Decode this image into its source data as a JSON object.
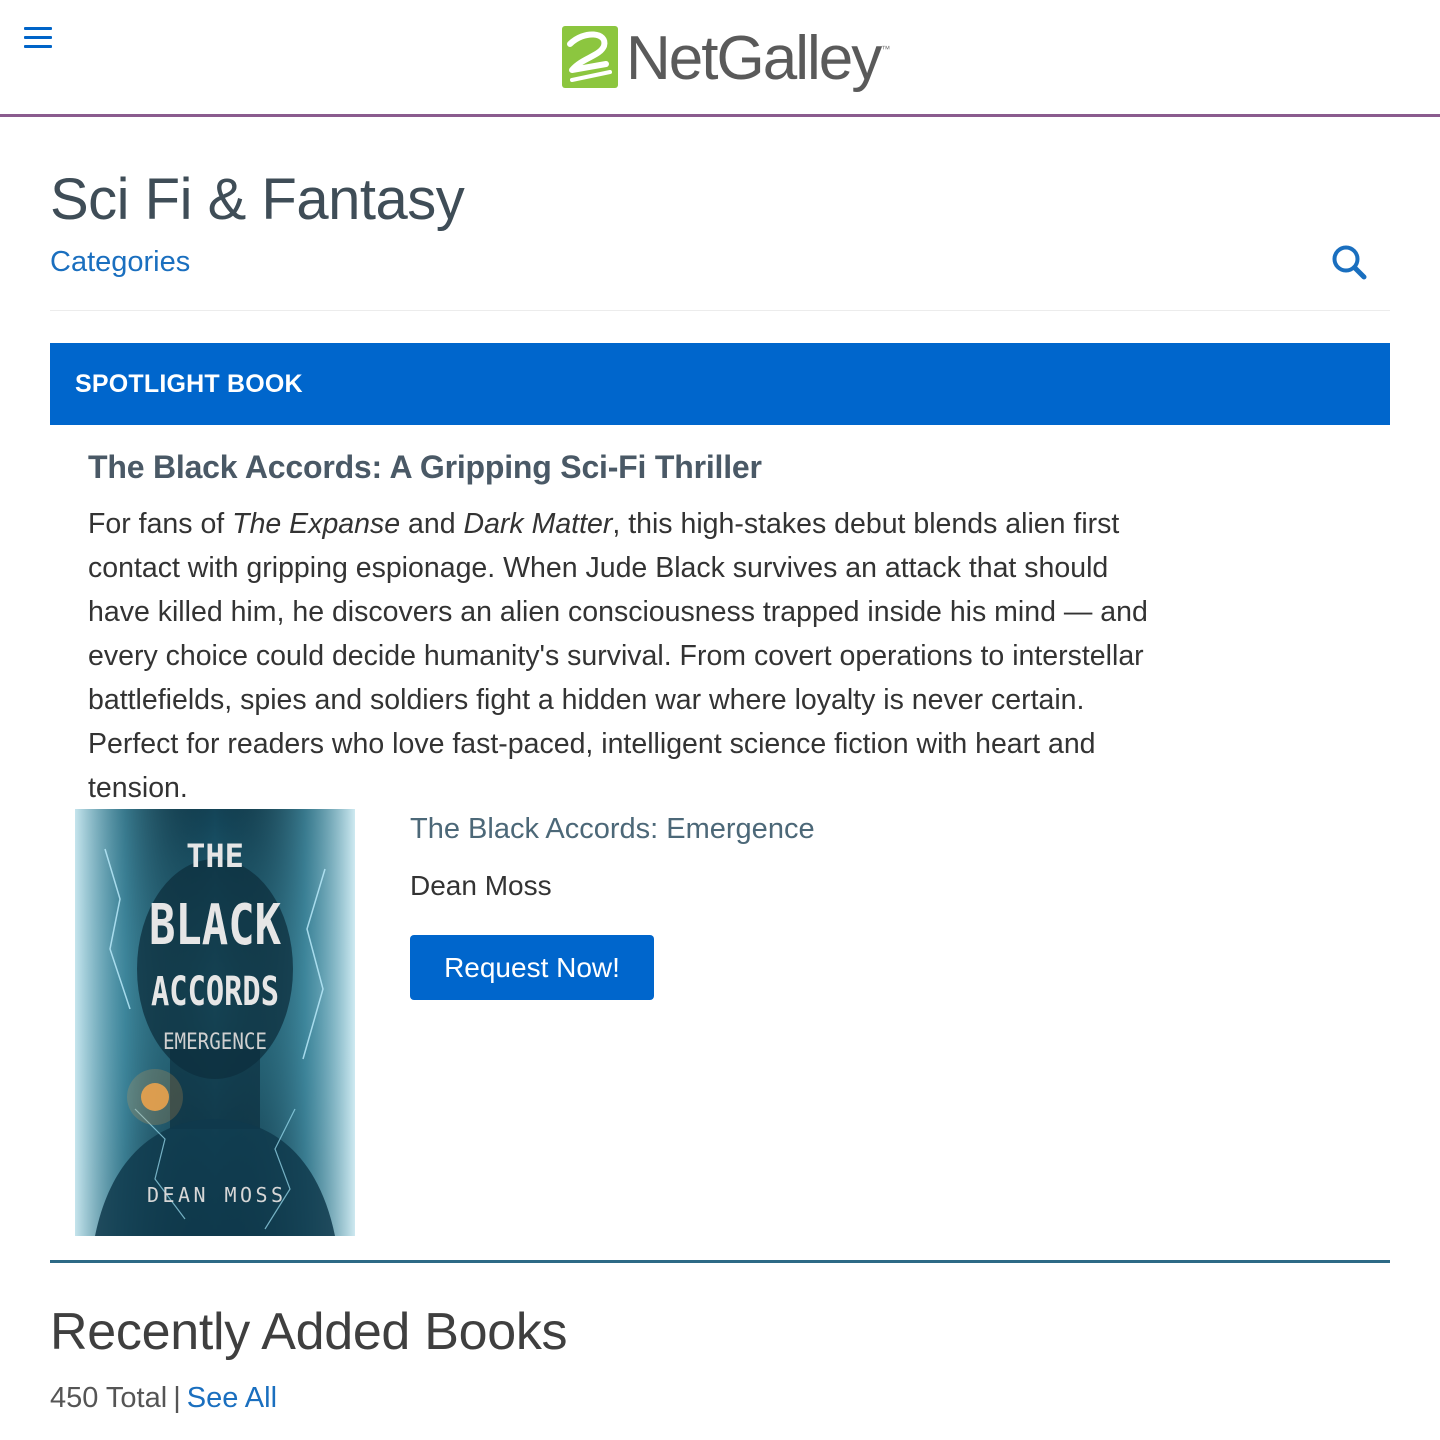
{
  "header": {
    "logo_text": "NetGalley",
    "logo_tm": "™",
    "menu_icon": "hamburger-menu-icon",
    "accent_color": "#8a5b8e"
  },
  "page": {
    "title": "Sci Fi & Fantasy",
    "categories_link": "Categories",
    "search_icon": "search-icon"
  },
  "spotlight": {
    "banner_label": "SPOTLIGHT BOOK",
    "banner_color": "#0066cc",
    "headline": "The Black Accords: A Gripping Sci-Fi Thriller",
    "description": {
      "p1": "For fans of ",
      "italic1": "The Expanse",
      "p2": " and ",
      "italic2": "Dark Matter",
      "p3": ", this high-stakes debut blends alien first contact with gripping espionage. When Jude Black survives an attack that should have killed him, he discovers an alien consciousness trapped inside his mind — and every choice could decide humanity's survival. From covert operations to interstellar battlefields, spies and soldiers fight a hidden war where loyalty is never certain. Perfect for readers who love fast-paced, intelligent science fiction with heart and tension."
    },
    "book": {
      "title": "The Black Accords: Emergence",
      "author": "Dean Moss",
      "request_button": "Request Now!",
      "cover": {
        "line1": "THE",
        "line2": "BLACK",
        "line3": "ACCORDS",
        "line4": "EMERGENCE",
        "author": "DEAN MOSS"
      }
    }
  },
  "recent": {
    "title": "Recently Added Books",
    "total": "450 Total",
    "separator": "|",
    "see_all": "See All"
  }
}
